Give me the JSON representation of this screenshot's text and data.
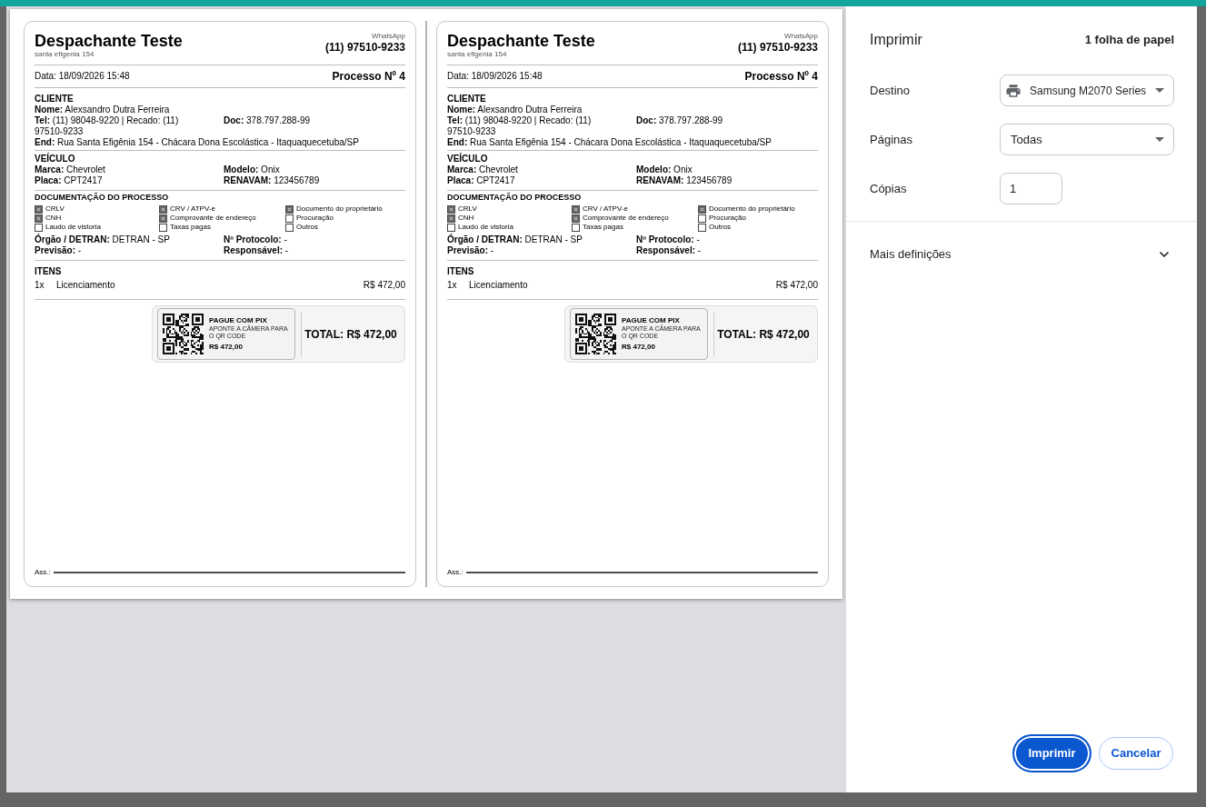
{
  "preview": {
    "receipts": [
      {
        "business": {
          "name": "Despachante Teste",
          "address": "santa efigenia 154",
          "contact_label": "WhatsApp",
          "phone": "(11) 97510-9233"
        },
        "date": "Data: 18/09/2026 15:48",
        "process": "Processo Nº 4",
        "client": {
          "heading": "CLIENTE",
          "rows": [
            [
              {
                "label": "Nome:",
                "value": "Alexsandro Dutra Ferreira"
              }
            ],
            [
              {
                "label": "Tel:",
                "value": "(11) 98048-9220 | Recado: (11) 97510-9233"
              },
              {
                "label": "Doc:",
                "value": "378.797.288-99"
              }
            ],
            [
              {
                "label": "End:",
                "value": "Rua Santa Efigênia 154 - Chácara Dona Escolástica - Itaquaquecetuba/SP"
              }
            ]
          ]
        },
        "vehicle": {
          "heading": "VEÍCULO",
          "rows": [
            [
              {
                "label": "Marca:",
                "value": "Chevrolet"
              },
              {
                "label": "Modelo:",
                "value": "Onix"
              }
            ],
            [
              {
                "label": "Placa:",
                "value": "CPT2417"
              },
              {
                "label": "RENAVAM:",
                "value": "123456789"
              }
            ]
          ]
        },
        "documents": {
          "heading": "DOCUMENTAÇÃO DO PROCESSO",
          "checklist": [
            {
              "label": "CRLV",
              "checked": true
            },
            {
              "label": "CRV / ATPV-e",
              "checked": true
            },
            {
              "label": "Documento do proprietário",
              "checked": true
            },
            {
              "label": "CNH",
              "checked": true
            },
            {
              "label": "Comprovante de endereço",
              "checked": true
            },
            {
              "label": "Procuração",
              "checked": false
            },
            {
              "label": "Laudo de vistoria",
              "checked": false
            },
            {
              "label": "Taxas pagas",
              "checked": false
            },
            {
              "label": "Outros",
              "checked": false
            }
          ],
          "rows": [
            [
              {
                "label": "Órgão / DETRAN:",
                "value": "DETRAN - SP"
              },
              {
                "label": "Nº Protocolo:",
                "value": "-"
              }
            ],
            [
              {
                "label": "Previsão:",
                "value": "-"
              },
              {
                "label": "Responsável:",
                "value": "-"
              }
            ]
          ]
        },
        "items": {
          "heading": "ITENS",
          "lines": [
            {
              "qty": "1x",
              "description": "Licenciamento",
              "price": "R$ 472,00"
            }
          ]
        },
        "payment": {
          "title": "PAGUE COM PIX",
          "instruction": "APONTE A CÂMERA PARA O QR CODE",
          "amount": "R$ 472,00",
          "total": "TOTAL: R$ 472,00"
        },
        "signature": {
          "label": "Ass.:"
        }
      },
      {
        "business": {
          "name": "Despachante Teste",
          "address": "santa efigenia 154",
          "contact_label": "WhatsApp",
          "phone": "(11) 97510-9233"
        },
        "date": "Data: 18/09/2026 15:48",
        "process": "Processo Nº 4",
        "client": {
          "heading": "CLIENTE",
          "rows": [
            [
              {
                "label": "Nome:",
                "value": "Alexsandro Dutra Ferreira"
              }
            ],
            [
              {
                "label": "Tel:",
                "value": "(11) 98048-9220 | Recado: (11) 97510-9233"
              },
              {
                "label": "Doc:",
                "value": "378.797.288-99"
              }
            ],
            [
              {
                "label": "End:",
                "value": "Rua Santa Efigênia 154 - Chácara Dona Escolástica - Itaquaquecetuba/SP"
              }
            ]
          ]
        },
        "vehicle": {
          "heading": "VEÍCULO",
          "rows": [
            [
              {
                "label": "Marca:",
                "value": "Chevrolet"
              },
              {
                "label": "Modelo:",
                "value": "Onix"
              }
            ],
            [
              {
                "label": "Placa:",
                "value": "CPT2417"
              },
              {
                "label": "RENAVAM:",
                "value": "123456789"
              }
            ]
          ]
        },
        "documents": {
          "heading": "DOCUMENTAÇÃO DO PROCESSO",
          "checklist": [
            {
              "label": "CRLV",
              "checked": true
            },
            {
              "label": "CRV / ATPV-e",
              "checked": true
            },
            {
              "label": "Documento do proprietário",
              "checked": true
            },
            {
              "label": "CNH",
              "checked": true
            },
            {
              "label": "Comprovante de endereço",
              "checked": true
            },
            {
              "label": "Procuração",
              "checked": false
            },
            {
              "label": "Laudo de vistoria",
              "checked": false
            },
            {
              "label": "Taxas pagas",
              "checked": false
            },
            {
              "label": "Outros",
              "checked": false
            }
          ],
          "rows": [
            [
              {
                "label": "Órgão / DETRAN:",
                "value": "DETRAN - SP"
              },
              {
                "label": "Nº Protocolo:",
                "value": "-"
              }
            ],
            [
              {
                "label": "Previsão:",
                "value": "-"
              },
              {
                "label": "Responsável:",
                "value": "-"
              }
            ]
          ]
        },
        "items": {
          "heading": "ITENS",
          "lines": [
            {
              "qty": "1x",
              "description": "Licenciamento",
              "price": "R$ 472,00"
            }
          ]
        },
        "payment": {
          "title": "PAGUE COM PIX",
          "instruction": "APONTE A CÂMERA PARA O QR CODE",
          "amount": "R$ 472,00",
          "total": "TOTAL: R$ 472,00"
        },
        "signature": {
          "label": "Ass.:"
        }
      }
    ]
  },
  "print_panel": {
    "title": "Imprimir",
    "sheet_count": "1 folha de papel",
    "fields": [
      {
        "kind": "device",
        "label": "Destino",
        "value": "Samsung M2070 Series"
      },
      {
        "kind": "select",
        "label": "Páginas",
        "value": "Todas"
      },
      {
        "kind": "number",
        "label": "Cópias",
        "value": "1"
      }
    ],
    "more_settings": {
      "label": "Mais definições",
      "expanded": false
    },
    "buttons": [
      {
        "kind": "primary",
        "label": "Imprimir"
      },
      {
        "kind": "secondary",
        "label": "Cancelar"
      }
    ]
  }
}
